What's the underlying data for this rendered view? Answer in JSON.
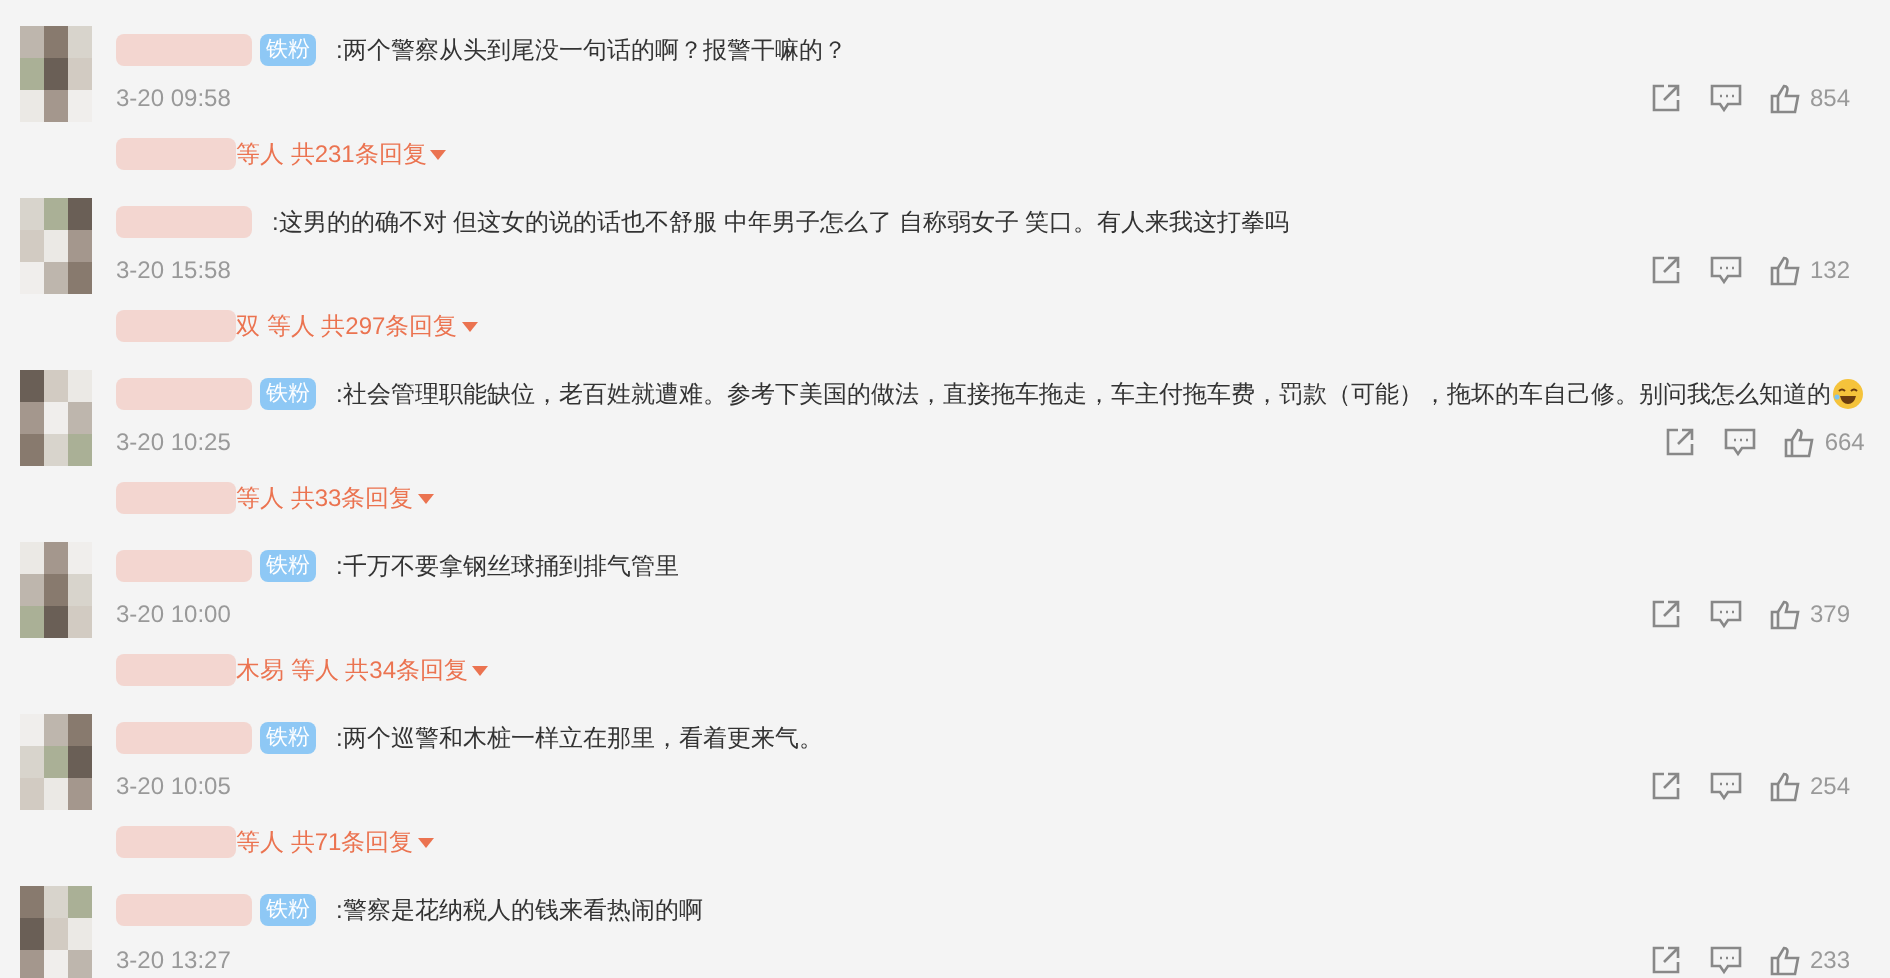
{
  "comments": [
    {
      "badge": "铁粉",
      "text": ":两个警察从头到尾没一句话的啊？报警干嘛的？",
      "date": "3-20 09:58",
      "likes": "854",
      "replies": "等人 共231条回复",
      "emoji": false
    },
    {
      "text": ":这男的的确不对 但这女的说的话也不舒服 中年男子怎么了 自称弱女子 笑口。有人来我这打拳吗",
      "date": "3-20 15:58",
      "likes": "132",
      "replies": "双 等人 共297条回复",
      "emoji": false
    },
    {
      "badge": "铁粉",
      "text": ":社会管理职能缺位，老百姓就遭难。参考下美国的做法，直接拖车拖走，车主付拖车费，罚款（可能），拖坏的车自己修。别问我怎么知道的",
      "date": "3-20 10:25",
      "likes": "664",
      "replies": "等人 共33条回复",
      "emoji": true
    },
    {
      "badge": "铁粉",
      "text": ":千万不要拿钢丝球捅到排气管里",
      "date": "3-20 10:00",
      "likes": "379",
      "replies": "木易 等人 共34条回复",
      "emoji": false
    },
    {
      "badge": "铁粉",
      "text": ":两个巡警和木桩一样立在那里，看着更来气。",
      "date": "3-20 10:05",
      "likes": "254",
      "replies": "等人 共71条回复",
      "emoji": false
    },
    {
      "badge": "铁粉",
      "text": ":警察是花纳税人的钱来看热闹的啊",
      "date": "3-20 13:27",
      "likes": "233",
      "emoji": false
    }
  ]
}
